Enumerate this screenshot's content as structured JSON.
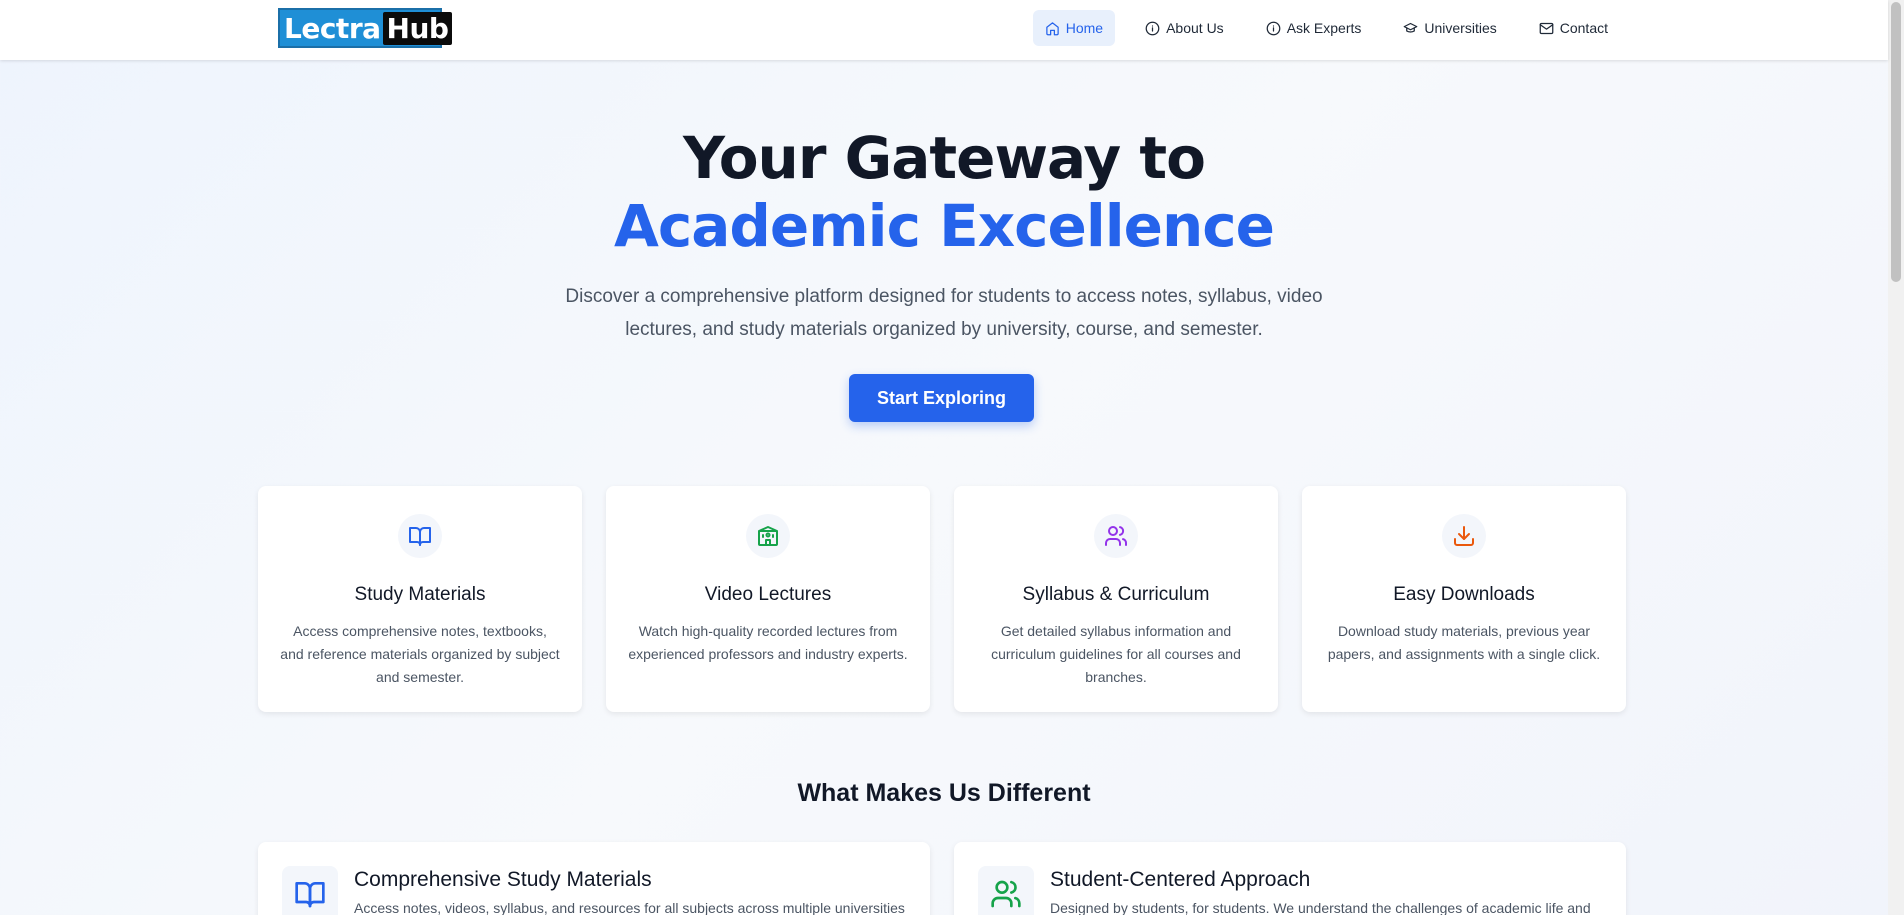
{
  "brand": {
    "part1": "Lectra",
    "part2": "Hub"
  },
  "nav": [
    {
      "label": "Home",
      "icon": "home-icon",
      "active": true
    },
    {
      "label": "About Us",
      "icon": "info-icon",
      "active": false
    },
    {
      "label": "Ask Experts",
      "icon": "info-icon",
      "active": false
    },
    {
      "label": "Universities",
      "icon": "graduation-cap-icon",
      "active": false
    },
    {
      "label": "Contact",
      "icon": "mail-icon",
      "active": false
    }
  ],
  "hero": {
    "line1": "Your Gateway to",
    "line2": "Academic Excellence",
    "subtitle": "Discover a comprehensive platform designed for students to access notes, syllabus, video lectures, and study materials organized by university, course, and semester.",
    "cta": "Start Exploring"
  },
  "features": [
    {
      "title": "Study Materials",
      "desc": "Access comprehensive notes, textbooks, and reference materials organized by subject and semester.",
      "icon": "book-open-icon",
      "color": "#2563eb"
    },
    {
      "title": "Video Lectures",
      "desc": "Watch high-quality recorded lectures from experienced professors and industry experts.",
      "icon": "school-icon",
      "color": "#16a34a"
    },
    {
      "title": "Syllabus & Curriculum",
      "desc": "Get detailed syllabus information and curriculum guidelines for all courses and branches.",
      "icon": "users-icon",
      "color": "#9333ea"
    },
    {
      "title": "Easy Downloads",
      "desc": "Download study materials, previous year papers, and assignments with a single click.",
      "icon": "download-icon",
      "color": "#ea580c"
    }
  ],
  "different": {
    "title": "What Makes Us Different",
    "items": [
      {
        "title": "Comprehensive Study Materials",
        "desc": "Access notes, videos, syllabus, and resources for all subjects across multiple universities",
        "icon": "book-open-icon",
        "color": "#2563eb"
      },
      {
        "title": "Student-Centered Approach",
        "desc": "Designed by students, for students. We understand the challenges of academic life and",
        "icon": "users-icon",
        "color": "#16a34a"
      }
    ]
  }
}
